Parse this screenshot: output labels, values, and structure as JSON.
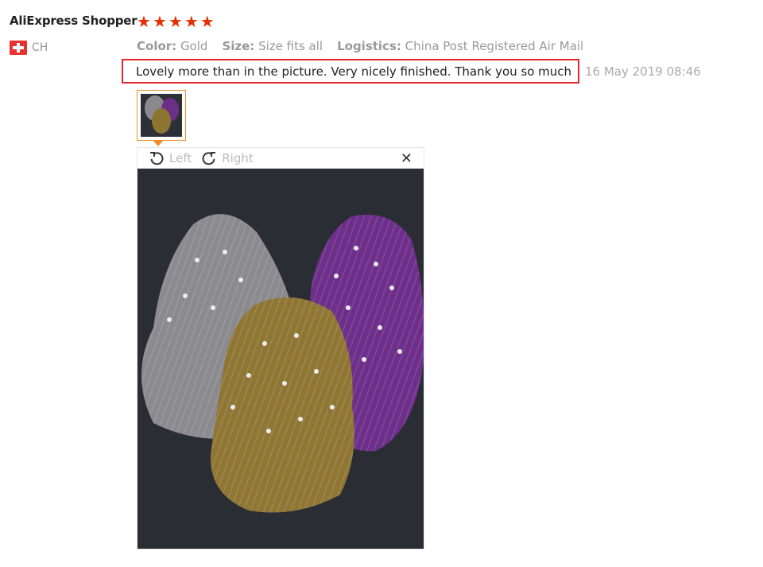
{
  "review": {
    "user_name": "AliExpress Shopper",
    "rating_stars": 5,
    "country_code": "CH",
    "attributes": [
      {
        "name": "Color:",
        "value": "Gold"
      },
      {
        "name": "Size:",
        "value": "Size fits all"
      },
      {
        "name": "Logistics:",
        "value": "China Post Registered Air Mail"
      }
    ],
    "text": "Lovely more than in the picture. Very nicely finished. Thank you so much",
    "date": "16 May 2019 08:46"
  },
  "viewer": {
    "rotate_left_label": "Left",
    "rotate_right_label": "Right",
    "close_glyph": "✕"
  },
  "colors": {
    "highlight_border": "#e0252b",
    "star": "#e62e04",
    "thumb_border": "#f08a24"
  }
}
